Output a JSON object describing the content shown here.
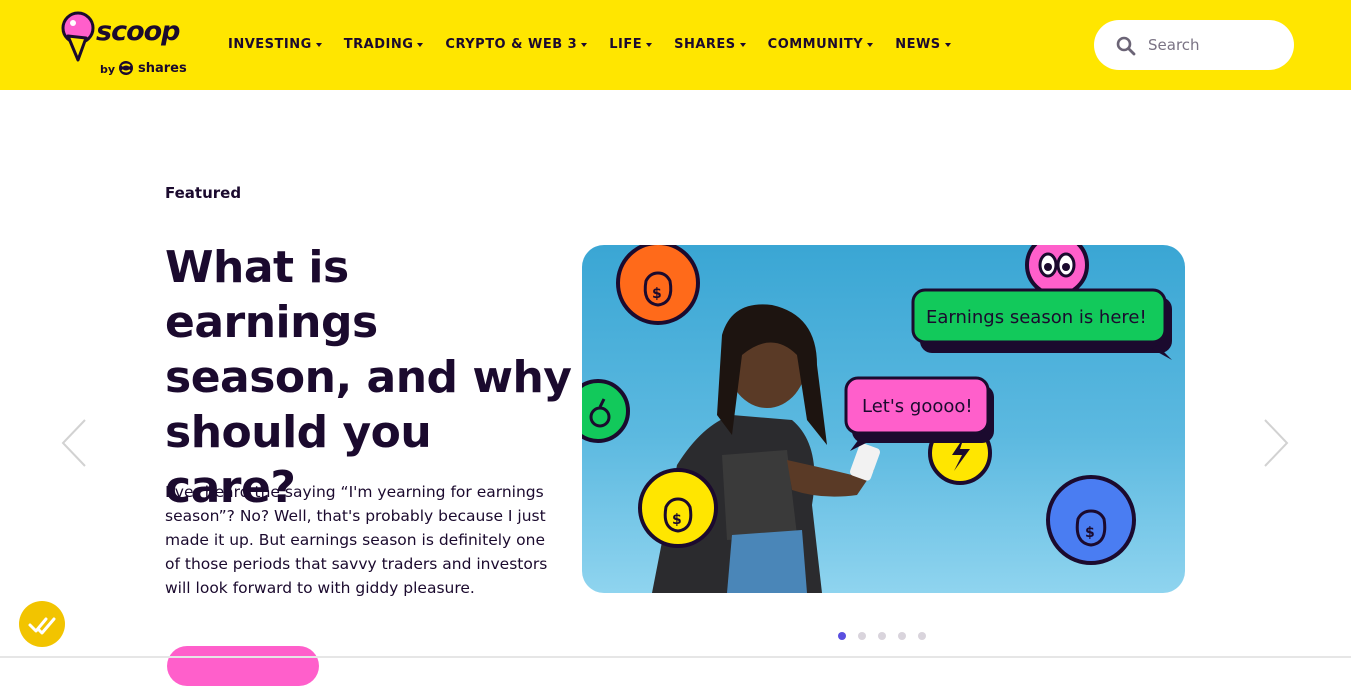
{
  "brand": {
    "name": "scoop",
    "by": "by",
    "parent": "shares",
    "colors": {
      "yellow": "#ffe600",
      "pink": "#ff5fcb",
      "ink": "#1b0a2e",
      "green": "#12c95b",
      "blue": "#4a7df2",
      "orange": "#ff6a1a"
    }
  },
  "nav": {
    "items": [
      {
        "label": "INVESTING"
      },
      {
        "label": "TRADING"
      },
      {
        "label": "CRYPTO & WEB 3"
      },
      {
        "label": "LIFE"
      },
      {
        "label": "SHARES"
      },
      {
        "label": "COMMUNITY"
      },
      {
        "label": "NEWS"
      }
    ]
  },
  "search": {
    "placeholder": "Search",
    "icon": "search-icon"
  },
  "featured": {
    "label": "Featured",
    "title": "What is earnings season, and why should you care?",
    "excerpt": "Ever heard the saying “I'm yearning for earnings season”? No? Well, that's probably because I just made it up. But earnings season is definitely one of those periods that savvy traders and investors will look forward to with giddy pleasure.",
    "image": {
      "bubble_green": "Earnings season is here!",
      "bubble_pink": "Let's goooo!"
    }
  },
  "carousel": {
    "slide_count": 5,
    "active_index": 0
  }
}
